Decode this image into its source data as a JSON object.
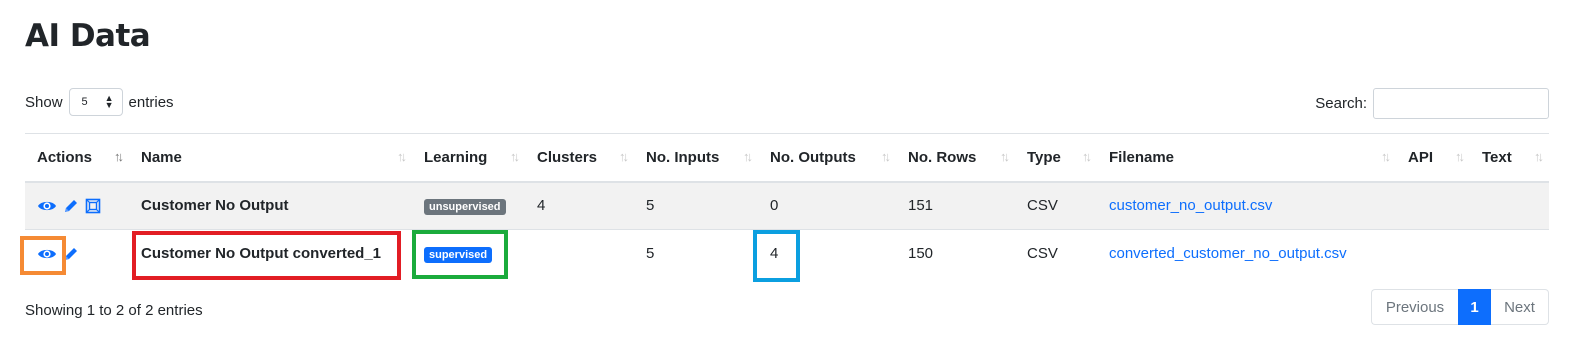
{
  "page": {
    "title": "AI Data"
  },
  "length_menu": {
    "show_label": "Show",
    "value": "5",
    "entries_label": "entries"
  },
  "search": {
    "label": "Search:",
    "value": ""
  },
  "columns": [
    "Actions",
    "Name",
    "Learning",
    "Clusters",
    "No. Inputs",
    "No. Outputs",
    "No. Rows",
    "Type",
    "Filename",
    "API",
    "Text"
  ],
  "rows": [
    {
      "name": "Customer No Output",
      "learning": "unsupervised",
      "clusters": "4",
      "inputs": "5",
      "outputs": "0",
      "rows": "151",
      "type": "CSV",
      "filename": "customer_no_output.csv",
      "api": "",
      "text": ""
    },
    {
      "name": "Customer No Output converted_1",
      "learning": "supervised",
      "clusters": "",
      "inputs": "5",
      "outputs": "4",
      "rows": "150",
      "type": "CSV",
      "filename": "converted_customer_no_output.csv",
      "api": "",
      "text": ""
    }
  ],
  "info": "Showing 1 to 2 of 2 entries",
  "pagination": {
    "previous": "Previous",
    "current": "1",
    "next": "Next"
  },
  "colors": {
    "link": "#0d6efd",
    "highlight_orange": "#f58a34",
    "highlight_red": "#e21d24",
    "highlight_green": "#1aab3c",
    "highlight_blue": "#0b9fe0"
  },
  "icons": {
    "view": "eye-icon",
    "edit": "pencil-icon",
    "cluster": "image-frame-icon"
  }
}
